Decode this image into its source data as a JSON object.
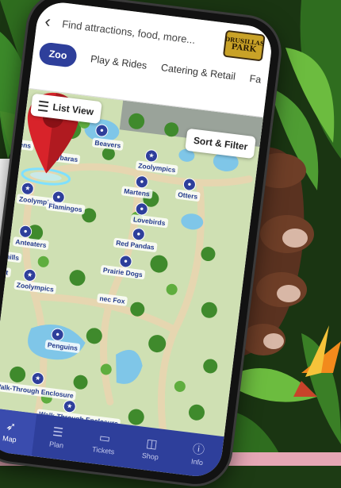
{
  "search": {
    "placeholder": "Find attractions, food, more..."
  },
  "logo": {
    "line1": "DRUSILLAS",
    "line2": "PARK"
  },
  "tabs": [
    {
      "label": "Zoo",
      "active": true
    },
    {
      "label": "Play & Rides"
    },
    {
      "label": "Catering & Retail"
    },
    {
      "label": "Fa"
    }
  ],
  "map": {
    "list_view_label": "List View",
    "sort_filter_label": "Sort & Filter",
    "area_text": "PARK",
    "labels": {
      "beavers": "Beavers",
      "capybaras": "Capybaras",
      "zoolympics_top": "Zoolympics",
      "martens": "Martens",
      "otters": "Otters",
      "zoolympics_left": "Zoolympics",
      "flamingos": "Flamingos",
      "lovebirds": "Lovebirds",
      "red_pandas": "Red Pandas",
      "anteaters": "Anteaters",
      "prairie_dogs": "Prairie Dogs",
      "hills": "hills",
      "zoolympics_mid": "Zoolympics",
      "fennec_fox": "nec Fox",
      "penguins": "Penguins",
      "walk_through_1": "Walk-Through Enclosure",
      "walk_through_2": "Walk-Through Enclosure",
      "ens": "ens",
      "et": "et"
    }
  },
  "bottom_nav": [
    {
      "label": "Map",
      "icon": "compass-icon",
      "active": true
    },
    {
      "label": "Plan",
      "icon": "plan-icon"
    },
    {
      "label": "Tickets",
      "icon": "ticket-icon"
    },
    {
      "label": "Shop",
      "icon": "bag-icon"
    },
    {
      "label": "Info",
      "icon": "info-icon"
    }
  ],
  "colors": {
    "brand_blue": "#2e3f9b",
    "pin_red": "#d8232a",
    "path_tan": "#e6d6b0",
    "water": "#7fc6e8"
  }
}
